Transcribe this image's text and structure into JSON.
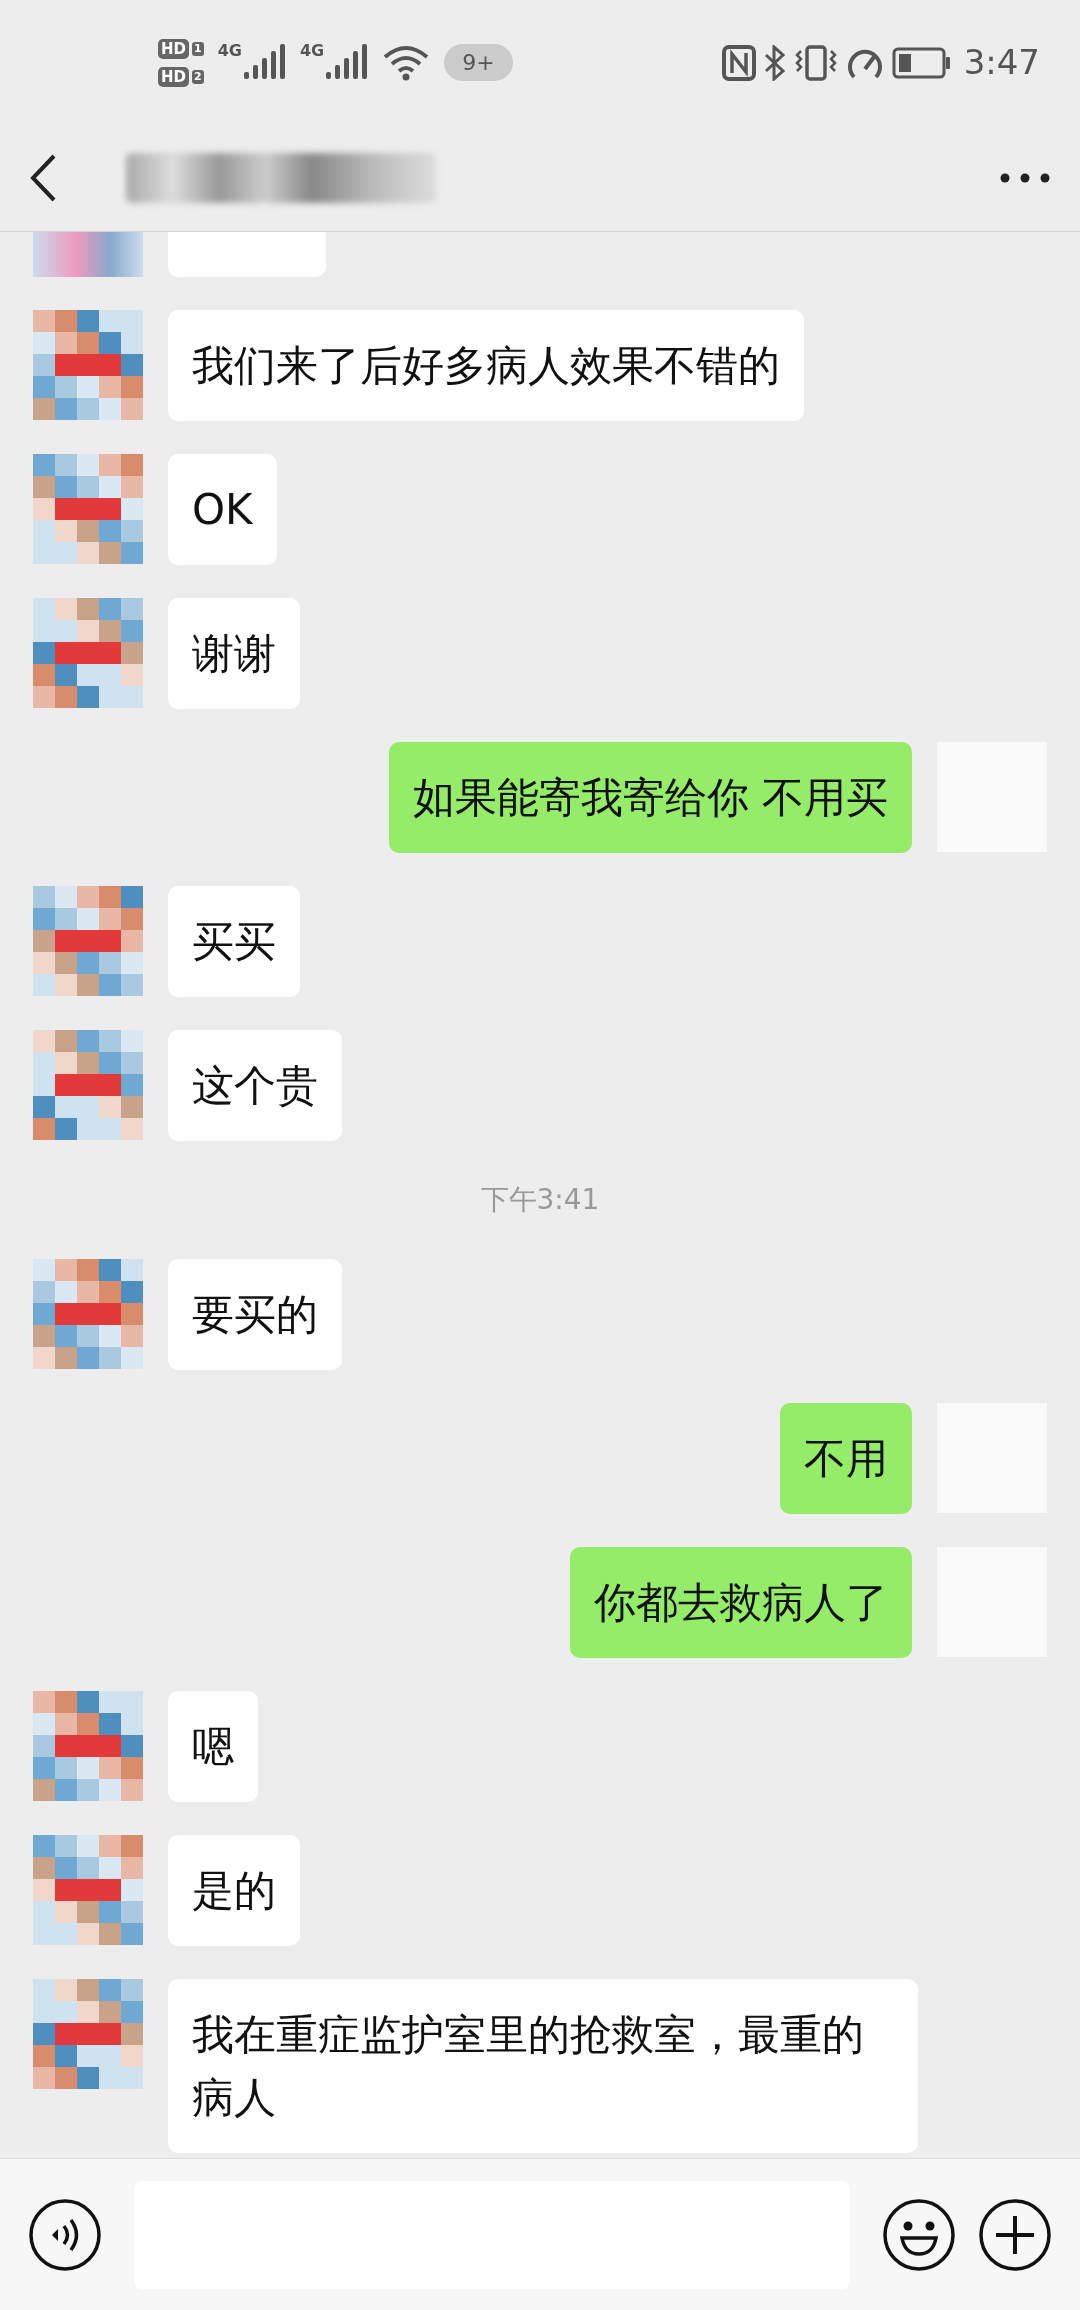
{
  "status_bar": {
    "sims": [
      {
        "label": "HD",
        "slot": "1"
      },
      {
        "label": "HD",
        "slot": "2"
      }
    ],
    "networks": [
      "4G",
      "4G"
    ],
    "notification_count": "9+",
    "time": "3:47"
  },
  "messages": [
    {
      "kind": "partial",
      "outgoing": false
    },
    {
      "kind": "text",
      "outgoing": false,
      "text": "我们来了后好多病人效果不错的"
    },
    {
      "kind": "text",
      "outgoing": false,
      "text": "OK"
    },
    {
      "kind": "text",
      "outgoing": false,
      "text": "谢谢"
    },
    {
      "kind": "text",
      "outgoing": true,
      "text": "如果能寄我寄给你 不用买"
    },
    {
      "kind": "text",
      "outgoing": false,
      "text": "买买"
    },
    {
      "kind": "text",
      "outgoing": false,
      "text": "这个贵"
    },
    {
      "kind": "time",
      "text": "下午3:41"
    },
    {
      "kind": "text",
      "outgoing": false,
      "text": "要买的"
    },
    {
      "kind": "text",
      "outgoing": true,
      "text": "不用"
    },
    {
      "kind": "text",
      "outgoing": true,
      "text": "你都去救病人了"
    },
    {
      "kind": "text",
      "outgoing": false,
      "text": "嗯"
    },
    {
      "kind": "text",
      "outgoing": false,
      "text": "是的"
    },
    {
      "kind": "text",
      "outgoing": false,
      "text": "我在重症监护室里的抢救室，最重的病人"
    }
  ]
}
